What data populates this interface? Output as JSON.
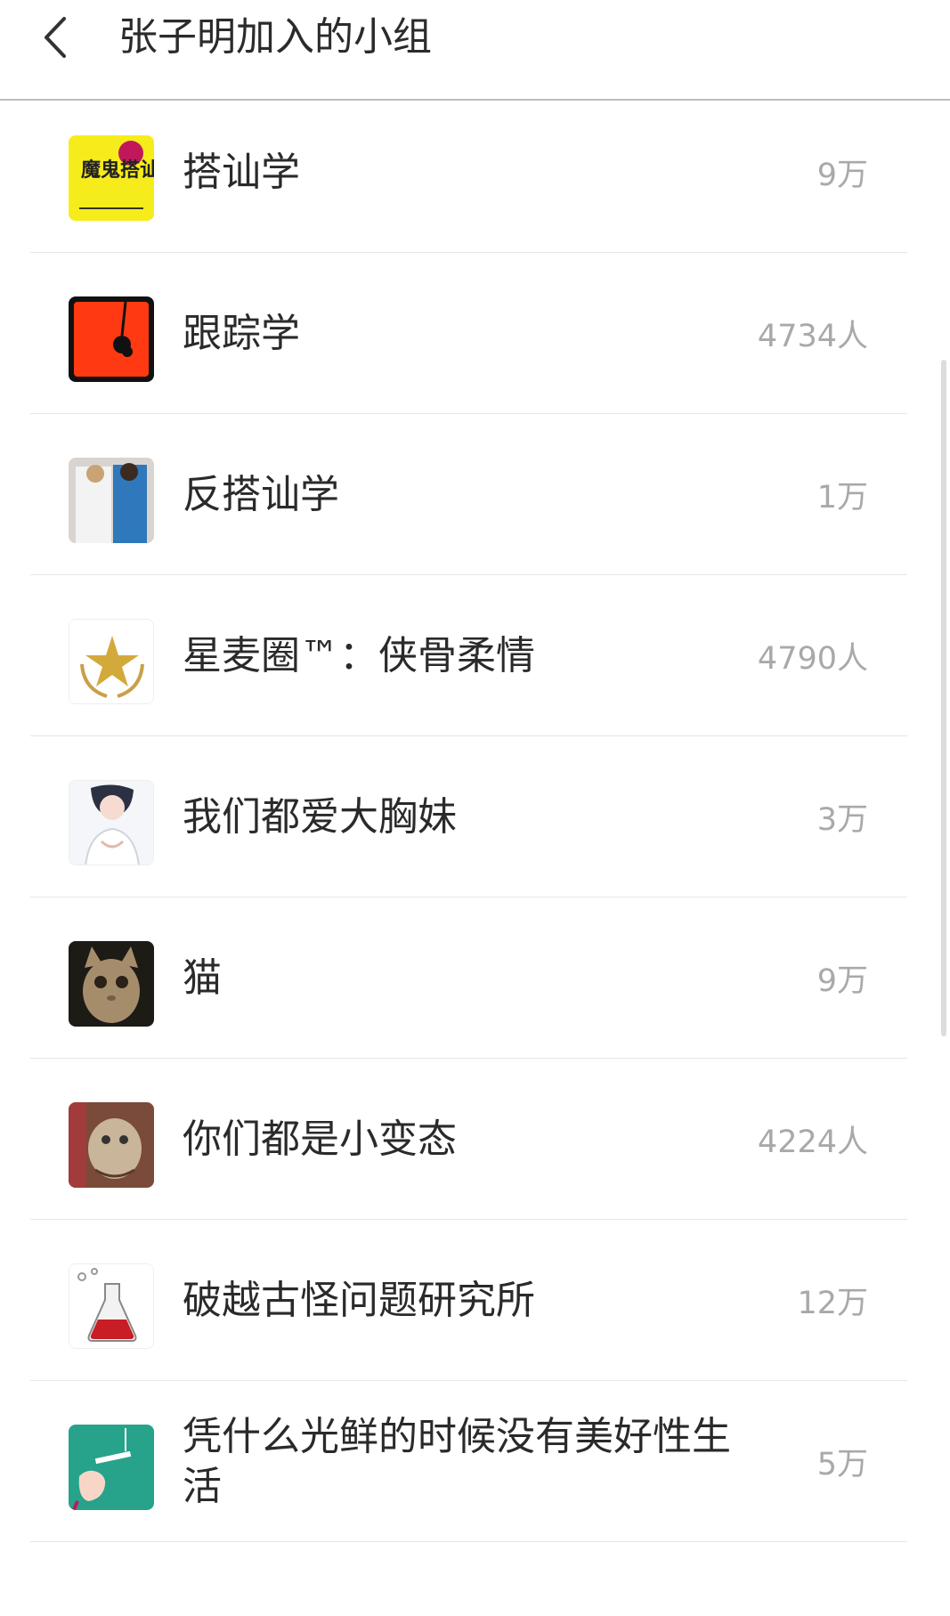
{
  "header": {
    "title": "张子明加入的小组"
  },
  "groups": [
    {
      "name": "",
      "count": ""
    },
    {
      "name": "搭讪学",
      "count": "9万"
    },
    {
      "name": "跟踪学",
      "count": "4734人"
    },
    {
      "name": "反搭讪学",
      "count": "1万"
    },
    {
      "name": "星麦圈™：侠骨柔情",
      "count": "4790人"
    },
    {
      "name": "我们都爱大胸妹",
      "count": "3万"
    },
    {
      "name": "猫",
      "count": "9万"
    },
    {
      "name": "你们都是小变态",
      "count": "4224人"
    },
    {
      "name": "破越古怪问题研究所",
      "count": "12万"
    },
    {
      "name": "凭什么光鲜的时候没有美好性生活",
      "count": "5万"
    }
  ],
  "avatar_book_text": "魔鬼搭讪学",
  "colors": {
    "title_text": "#2b2b2b",
    "count_text": "#a9a9a9",
    "divider": "#e6e6e6",
    "header_border": "#bdbdbd"
  },
  "icons": {
    "back": "chevron-left-icon"
  }
}
